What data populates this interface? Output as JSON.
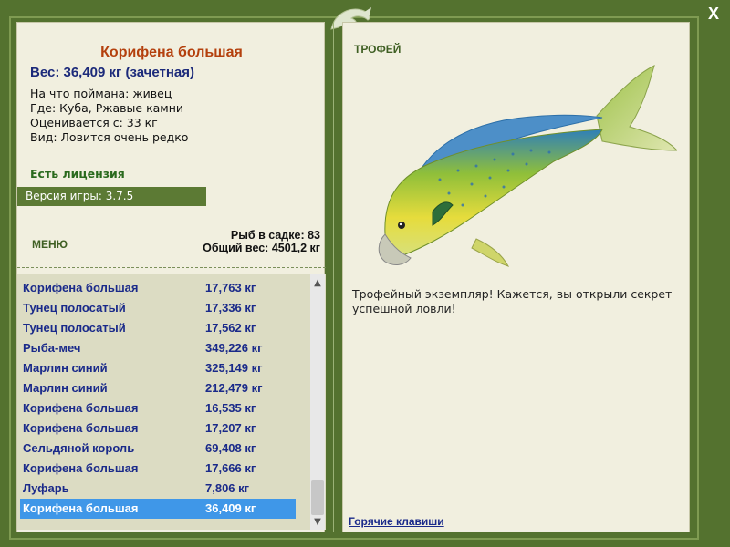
{
  "close_label": "X",
  "fish": {
    "title": "Корифена большая",
    "weight_line": "Вес: 36,409 кг (зачетная)",
    "info": [
      "На что поймана: живец",
      "Где: Куба, Ржавые камни",
      "Оценивается с: 33 кг",
      "Вид: Ловится очень редко"
    ]
  },
  "license": "Есть лицензия",
  "version": "Версия игры: 3.7.5",
  "menu_label": "МЕНЮ",
  "stats": {
    "count_line": "Рыб в садке: 83",
    "total_line": "Общий вес: 4501,2 кг"
  },
  "catch_list": [
    {
      "name": "Корифена большая",
      "weight": "17,763 кг"
    },
    {
      "name": "Тунец полосатый",
      "weight": "17,336 кг"
    },
    {
      "name": "Тунец полосатый",
      "weight": "17,562 кг"
    },
    {
      "name": "Рыба-меч",
      "weight": "349,226 кг"
    },
    {
      "name": "Марлин синий",
      "weight": "325,149 кг"
    },
    {
      "name": "Марлин синий",
      "weight": "212,479 кг"
    },
    {
      "name": "Корифена большая",
      "weight": "16,535 кг"
    },
    {
      "name": "Корифена большая",
      "weight": "17,207 кг"
    },
    {
      "name": "Сельдяной король",
      "weight": "69,408 кг"
    },
    {
      "name": "Корифена большая",
      "weight": "17,666 кг"
    },
    {
      "name": "Луфарь",
      "weight": "7,806 кг"
    },
    {
      "name": "Корифена большая",
      "weight": "36,409 кг",
      "selected": true
    }
  ],
  "trophy_label": "ТРОФЕЙ",
  "trophy_text": "Трофейный экземпляр! Кажется, вы открыли секрет успешной ловли!",
  "hotkeys_label": "Горячие клавиши",
  "colors": {
    "frame": "#54722f",
    "panel": "#f1efdf",
    "list_bg": "#dcdcc3",
    "selection": "#3f97e8",
    "title": "#b4400d",
    "link": "#1a2a8a"
  }
}
